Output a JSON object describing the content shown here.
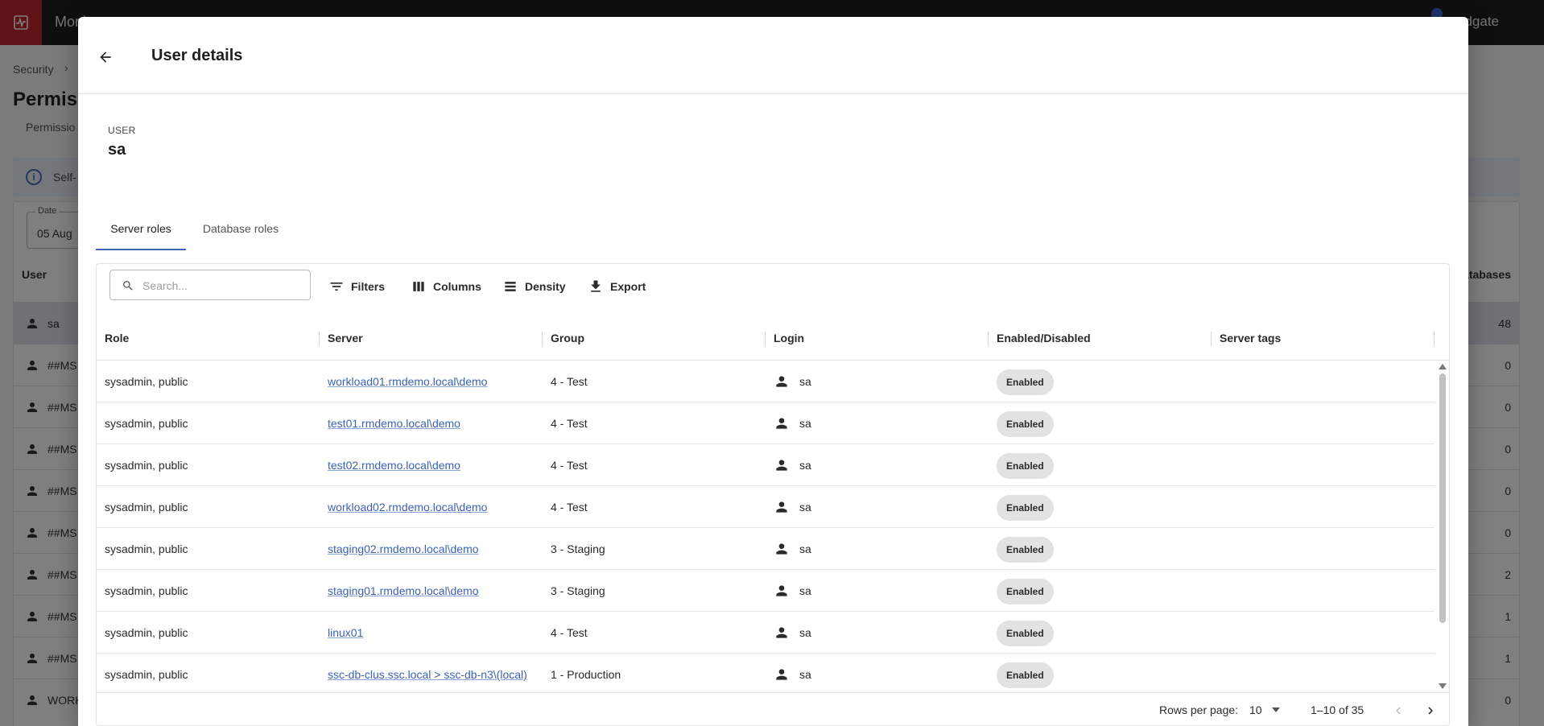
{
  "app": {
    "title": "Moni",
    "brand": "edgate"
  },
  "background": {
    "breadcrumb": "Security",
    "breadcrumb_chevron": "›",
    "page_title": "Permiss",
    "tab": "Permissio",
    "info_text": "Self-",
    "date_label": "Date",
    "date_value": "05 Aug",
    "col_user": "User",
    "col_databases": "atabases",
    "rows": [
      {
        "name": "sa",
        "count": "48"
      },
      {
        "name": "##MS",
        "count": "0"
      },
      {
        "name": "##MS",
        "count": "0"
      },
      {
        "name": "##MS",
        "count": "0"
      },
      {
        "name": "##MS",
        "count": "0"
      },
      {
        "name": "##MS",
        "count": "0"
      },
      {
        "name": "##MS",
        "count": "2"
      },
      {
        "name": "##MS",
        "count": "1"
      },
      {
        "name": "##MS",
        "count": "1"
      },
      {
        "name": "WORK",
        "count": "0"
      }
    ]
  },
  "dialog": {
    "title": "User details",
    "user_label": "USER",
    "user_name": "sa",
    "tabs": [
      {
        "label": "Server roles",
        "active": true
      },
      {
        "label": "Database roles",
        "active": false
      }
    ],
    "toolbar": {
      "search_placeholder": "Search...",
      "filters": "Filters",
      "columns": "Columns",
      "density": "Density",
      "export": "Export"
    },
    "columns": [
      "Role",
      "Server",
      "Group",
      "Login",
      "Enabled/Disabled",
      "Server tags"
    ],
    "rows": [
      {
        "role": "sysadmin, public",
        "server": "workload01.rmdemo.local\\demo",
        "group": "4 - Test",
        "login": "sa",
        "status": "Enabled",
        "tags": ""
      },
      {
        "role": "sysadmin, public",
        "server": "test01.rmdemo.local\\demo",
        "group": "4 - Test",
        "login": "sa",
        "status": "Enabled",
        "tags": ""
      },
      {
        "role": "sysadmin, public",
        "server": "test02.rmdemo.local\\demo",
        "group": "4 - Test",
        "login": "sa",
        "status": "Enabled",
        "tags": ""
      },
      {
        "role": "sysadmin, public",
        "server": "workload02.rmdemo.local\\demo",
        "group": "4 - Test",
        "login": "sa",
        "status": "Enabled",
        "tags": ""
      },
      {
        "role": "sysadmin, public",
        "server": "staging02.rmdemo.local\\demo",
        "group": "3 - Staging",
        "login": "sa",
        "status": "Enabled",
        "tags": ""
      },
      {
        "role": "sysadmin, public",
        "server": "staging01.rmdemo.local\\demo",
        "group": "3 - Staging",
        "login": "sa",
        "status": "Enabled",
        "tags": ""
      },
      {
        "role": "sysadmin, public",
        "server": "linux01",
        "group": "4 - Test",
        "login": "sa",
        "status": "Enabled",
        "tags": ""
      },
      {
        "role": "sysadmin, public",
        "server": "ssc-db-clus.ssc.local > ssc-db-n3\\(local)",
        "group": "1 - Production",
        "login": "sa",
        "status": "Enabled",
        "tags": ""
      }
    ],
    "pagination": {
      "rows_per_page_label": "Rows per page:",
      "rows_per_page": "10",
      "range": "1–10 of 35"
    }
  },
  "colors": {
    "app_bar": "#1e1e1e",
    "logo": "#c0262d",
    "link": "#3d62b3",
    "tab_indicator": "#3f63ad",
    "chip": "#e2e2e2"
  },
  "icons": {
    "back": "arrow-left-icon",
    "search": "search-icon",
    "filters": "filter-icon",
    "columns": "columns-icon",
    "density": "density-icon",
    "export": "download-icon",
    "login": "person-icon",
    "prev": "chevron-left-icon",
    "next": "chevron-right-icon"
  }
}
